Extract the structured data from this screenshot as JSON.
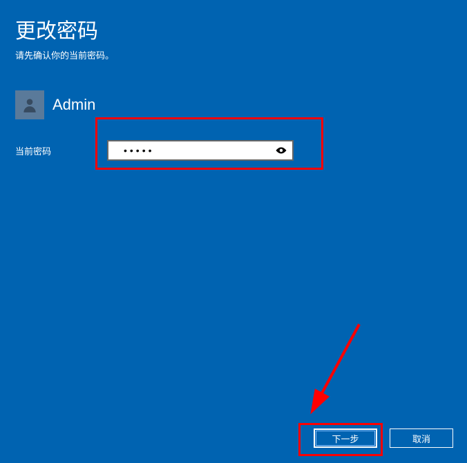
{
  "title": "更改密码",
  "subtitle": "请先确认你的当前密码。",
  "user": {
    "name": "Admin"
  },
  "fields": {
    "current_password_label": "当前密码",
    "password_value": "•••••"
  },
  "buttons": {
    "next": "下一步",
    "cancel": "取消"
  }
}
